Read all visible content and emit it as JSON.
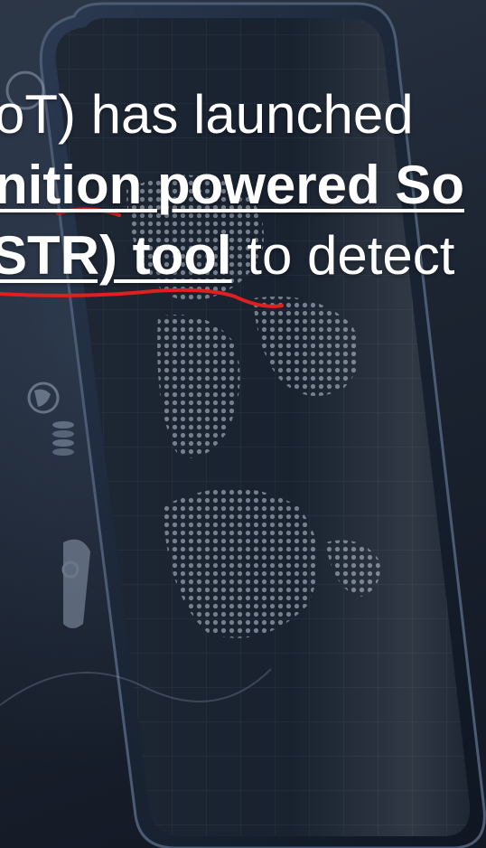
{
  "slide": {
    "line1": "oT) has launched",
    "line2": "nition powered So",
    "line3_bold": "STR) tool",
    "line3_rest": " to detect"
  },
  "colors": {
    "text": "#ffffff",
    "annotation": "#e02020",
    "background": "#1b2230"
  }
}
